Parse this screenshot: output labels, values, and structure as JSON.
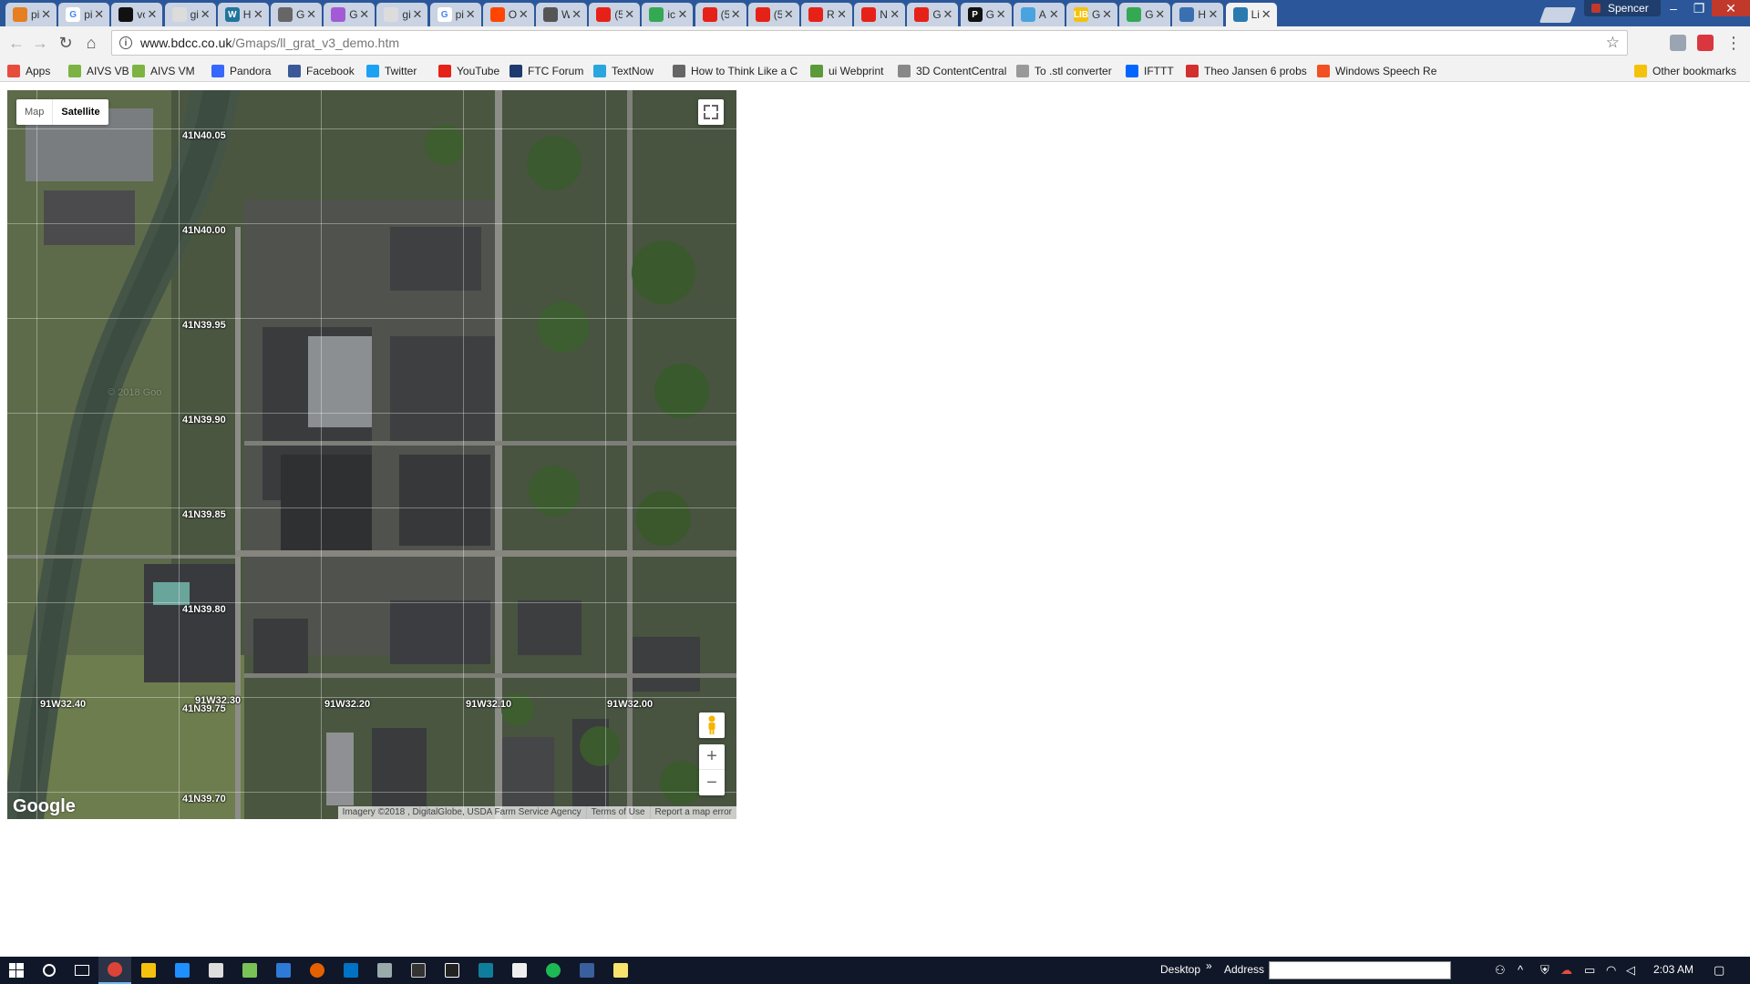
{
  "tabs": [
    {
      "title": "pi",
      "fav": "#e67e22",
      "letter": ""
    },
    {
      "title": "pi",
      "fav": "#ffffff",
      "letter": "G"
    },
    {
      "title": "vc",
      "fav": "#111111",
      "letter": ""
    },
    {
      "title": "gi",
      "fav": "#dcdcdc",
      "letter": ""
    },
    {
      "title": "H",
      "fav": "#21759b",
      "letter": "W"
    },
    {
      "title": "G",
      "fav": "#666666",
      "letter": ""
    },
    {
      "title": "G",
      "fav": "#a25bd4",
      "letter": ""
    },
    {
      "title": "gi",
      "fav": "#dcdcdc",
      "letter": ""
    },
    {
      "title": "pi",
      "fav": "#ffffff",
      "letter": "G"
    },
    {
      "title": "O",
      "fav": "#ff4500",
      "letter": ""
    },
    {
      "title": "W",
      "fav": "#555555",
      "letter": ""
    },
    {
      "title": "(5",
      "fav": "#e62117",
      "letter": ""
    },
    {
      "title": "ic",
      "fav": "#34a853",
      "letter": ""
    },
    {
      "title": "(5",
      "fav": "#e62117",
      "letter": ""
    },
    {
      "title": "(5",
      "fav": "#e62117",
      "letter": ""
    },
    {
      "title": "R",
      "fav": "#e62117",
      "letter": ""
    },
    {
      "title": "N",
      "fav": "#e62117",
      "letter": ""
    },
    {
      "title": "G",
      "fav": "#e62117",
      "letter": ""
    },
    {
      "title": "G",
      "fav": "#111111",
      "letter": "P"
    },
    {
      "title": "A",
      "fav": "#4aa3df",
      "letter": ""
    },
    {
      "title": "G",
      "fav": "#f4c20d",
      "letter": "LIB"
    },
    {
      "title": "G",
      "fav": "#34a853",
      "letter": ""
    },
    {
      "title": "H",
      "fav": "#3a6fb0",
      "letter": ""
    },
    {
      "title": "Li",
      "fav": "#2a7ab0",
      "letter": ""
    }
  ],
  "profile": "Spencer",
  "url": {
    "host": "www.bdcc.co.uk",
    "path": "/Gmaps/ll_grat_v3_demo.htm"
  },
  "bookmarks": [
    {
      "label": "Apps",
      "color": "#e74c3c"
    },
    {
      "label": "AIVS VB",
      "color": "#7cb342"
    },
    {
      "label": "AIVS VM",
      "color": "#7cb342"
    },
    {
      "label": "Pandora",
      "color": "#3668ff"
    },
    {
      "label": "Facebook",
      "color": "#3b5998"
    },
    {
      "label": "Twitter",
      "color": "#1da1f2"
    },
    {
      "label": "YouTube",
      "color": "#e62117"
    },
    {
      "label": "FTC Forum",
      "color": "#1e3a6e"
    },
    {
      "label": "TextNow",
      "color": "#2aa6df"
    },
    {
      "label": "How to Think Like a C",
      "color": "#666666"
    },
    {
      "label": "ui Webprint",
      "color": "#5b9a3a"
    },
    {
      "label": "3D ContentCentral",
      "color": "#888888"
    },
    {
      "label": "To .stl converter",
      "color": "#999999"
    },
    {
      "label": "IFTTT",
      "color": "#0066ff"
    },
    {
      "label": "Theo Jansen 6 probs",
      "color": "#d32f2f"
    },
    {
      "label": "Windows Speech Re",
      "color": "#f25022"
    },
    {
      "label": "Other bookmarks",
      "color": "#f4c20d"
    }
  ],
  "map": {
    "type_control": {
      "map": "Map",
      "satellite": "Satellite"
    },
    "lat_labels": [
      "41N40.05",
      "41N40.00",
      "41N39.95",
      "41N39.90",
      "41N39.85",
      "41N39.80",
      "41N39.75",
      "41N39.70"
    ],
    "lng_labels": [
      "91W32.40",
      "91W32.30",
      "91W32.20",
      "91W32.10",
      "91W32.00"
    ],
    "watermark": "© 2018 Goo",
    "google": "Google",
    "attribution": [
      "Imagery ©2018 , DigitalGlobe, USDA Farm Service Agency",
      "Terms of Use",
      "Report a map error"
    ],
    "zoom_in": "+",
    "zoom_out": "−"
  },
  "taskbar": {
    "desktop": "Desktop",
    "chevron": "»",
    "address": "Address",
    "time": "2:03 AM"
  }
}
